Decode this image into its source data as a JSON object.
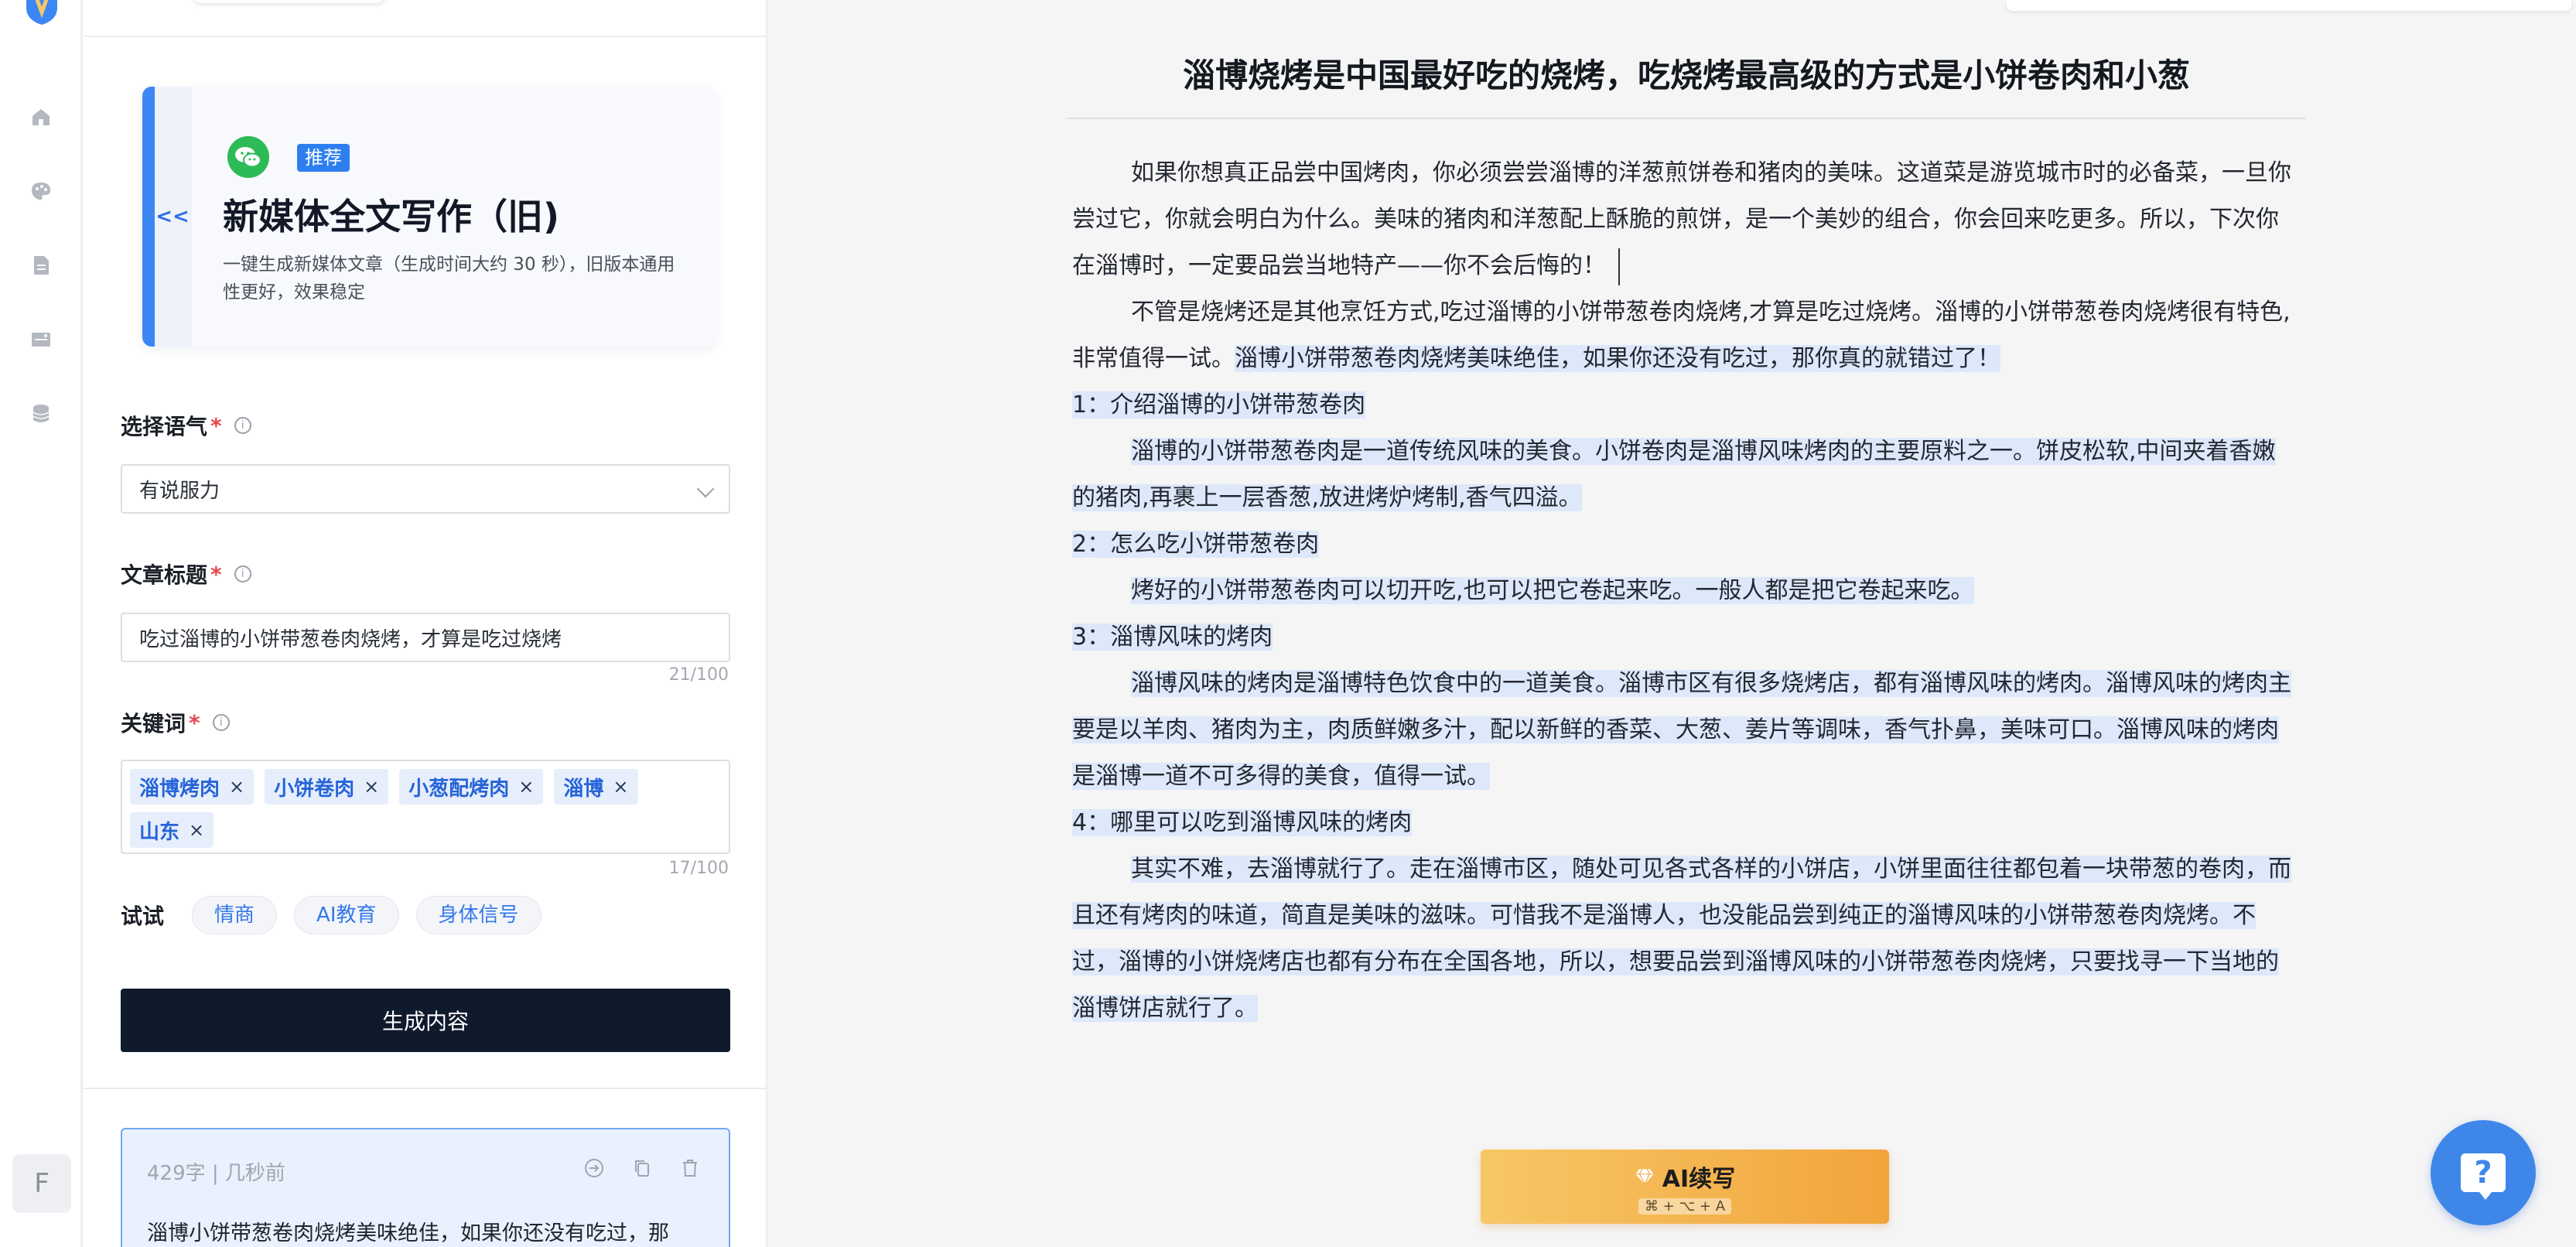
{
  "sidebar": {
    "icons": [
      "home-icon",
      "palette-icon",
      "document-icon",
      "media-icon",
      "database-icon"
    ],
    "avatar_letter": "F"
  },
  "card": {
    "collapse_label": "<<",
    "badge": "推荐",
    "title": "新媒体全文写作（旧)",
    "description": "一键生成新媒体文章（生成时间大约 30 秒），旧版本通用性更好，效果稳定"
  },
  "form": {
    "tone_label": "选择语气",
    "tone_value": "有说服力",
    "title_label": "文章标题",
    "title_value": "吃过淄博的小饼带葱卷肉烧烤，才算是吃过烧烤",
    "title_counter": "21/100",
    "keywords_label": "关键词",
    "keywords": [
      "淄博烤肉",
      "小饼卷肉",
      "小葱配烤肉",
      "淄博",
      "山东"
    ],
    "keywords_counter": "17/100",
    "try_label": "试试",
    "try_chips": [
      "情商",
      "AI教育",
      "身体信号"
    ],
    "generate_label": "生成内容",
    "required_mark": "*"
  },
  "history": {
    "meta": "429字 | 几秒前",
    "preview": "淄博小饼带葱卷肉烧烤美味绝佳，如果你还没有吃过，那"
  },
  "editor": {
    "title": "淄博烧烤是中国最好吃的烧烤，吃烧烤最高级的方式是小饼卷肉和小葱",
    "p1": "如果你想真正品尝中国烤肉，你必须尝尝淄博的洋葱煎饼卷和猪肉的美味。这道菜是游览城市时的必备菜，一旦你尝过它，你就会明白为什么。美味的猪肉和洋葱配上酥脆的煎饼，是一个美妙的组合，你会回来吃更多。所以，下次你在淄博时，一定要品尝当地特产——你不会后悔的！",
    "p2_plain": "不管是烧烤还是其他烹饪方式,吃过淄博的小饼带葱卷肉烧烤,才算是吃过烧烤。淄博的小饼带葱卷肉烧烤很有特色,非常值得一试。",
    "p2_hl": "淄博小饼带葱卷肉烧烤美味绝佳，如果你还没有吃过，那你真的就错过了！",
    "h1": "1：介绍淄博的小饼带葱卷肉",
    "p3": "淄博的小饼带葱卷肉是一道传统风味的美食。小饼卷肉是淄博风味烤肉的主要原料之一。饼皮松软,中间夹着香嫩的猪肉,再裹上一层香葱,放进烤炉烤制,香气四溢。",
    "h2": "2：怎么吃小饼带葱卷肉",
    "p4": "烤好的小饼带葱卷肉可以切开吃,也可以把它卷起来吃。一般人都是把它卷起来吃。",
    "h3": "3：淄博风味的烤肉",
    "p5": "淄博风味的烤肉是淄博特色饮食中的一道美食。淄博市区有很多烧烤店，都有淄博风味的烤肉。淄博风味的烤肉主要是以羊肉、猪肉为主，肉质鲜嫩多汁，配以新鲜的香菜、大葱、姜片等调味，香气扑鼻，美味可口。淄博风味的烤肉是淄博一道不可多得的美食，值得一试。",
    "h4": "4：哪里可以吃到淄博风味的烤肉",
    "p6": "其实不难，去淄博就行了。走在淄博市区，随处可见各式各样的小饼店，小饼里面往往都包着一块带葱的卷肉，而且还有烤肉的味道，简直是美味的滋味。可惜我不是淄博人，也没能品尝到纯正的淄博风味的小饼带葱卷肉烧烤。不过，淄博的小饼烧烤店也都有分布在全国各地，所以，想要品尝到淄博风味的小饼带葱卷肉烧烤，只要找寻一下当地的淄博饼店就行了。"
  },
  "ai_button": {
    "label": "AI续写",
    "shortcut": "⌘ + ⌥ + A"
  },
  "help": {
    "label": "?"
  },
  "colors": {
    "accent": "#3d87f5",
    "dark_button": "#0f1a2c",
    "highlight": "#dde8fa",
    "ai_gradient_start": "#f7c766",
    "ai_gradient_end": "#f2a43c"
  }
}
